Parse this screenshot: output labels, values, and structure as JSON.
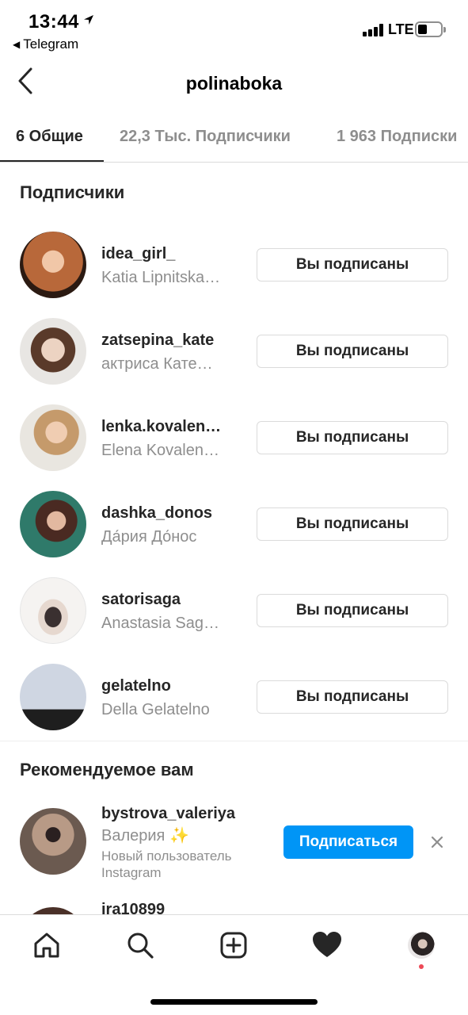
{
  "status": {
    "time": "13:44",
    "back_app": "Telegram",
    "network": "LTE"
  },
  "header": {
    "title": "polinaboka"
  },
  "tabs": [
    {
      "label": "6 Общие"
    },
    {
      "label": "22,3 Тыс. Подписчики"
    },
    {
      "label": "1 963 Подписки"
    }
  ],
  "followers_section": {
    "title": "Подписчики",
    "button_label": "Вы подписаны",
    "users": [
      {
        "username": "idea_girl_",
        "fullname": "Katia Lipnitska…"
      },
      {
        "username": "zatsepina_kate",
        "fullname": "актриса Кате…"
      },
      {
        "username": "lenka.kovalen…",
        "fullname": "Elena  Kovalen…"
      },
      {
        "username": "dashka_donos",
        "fullname": "Да́рия До́нос"
      },
      {
        "username": "satorisaga",
        "fullname": "Anastasia Sag…"
      },
      {
        "username": "gelatelno",
        "fullname": "Della Gelatelno"
      }
    ]
  },
  "recommended_section": {
    "title": "Рекомендуемое вам",
    "users": [
      {
        "username": "bystrova_valeriya",
        "fullname": "Валерия ✨",
        "note_line1": "Новый пользователь",
        "note_line2": "Instagram",
        "subscribe_label": "Подписаться"
      },
      {
        "username": "ira10899"
      }
    ]
  },
  "colors": {
    "primary_text": "#262626",
    "secondary_text": "#8e8e8e",
    "accent_blue": "#0095f6",
    "notification_dot": "#ed4956",
    "border": "#dbdbdb"
  },
  "tab_bar": {
    "icons": [
      "home-icon",
      "search-icon",
      "new-post-icon",
      "activity-heart-icon",
      "profile-avatar"
    ]
  }
}
